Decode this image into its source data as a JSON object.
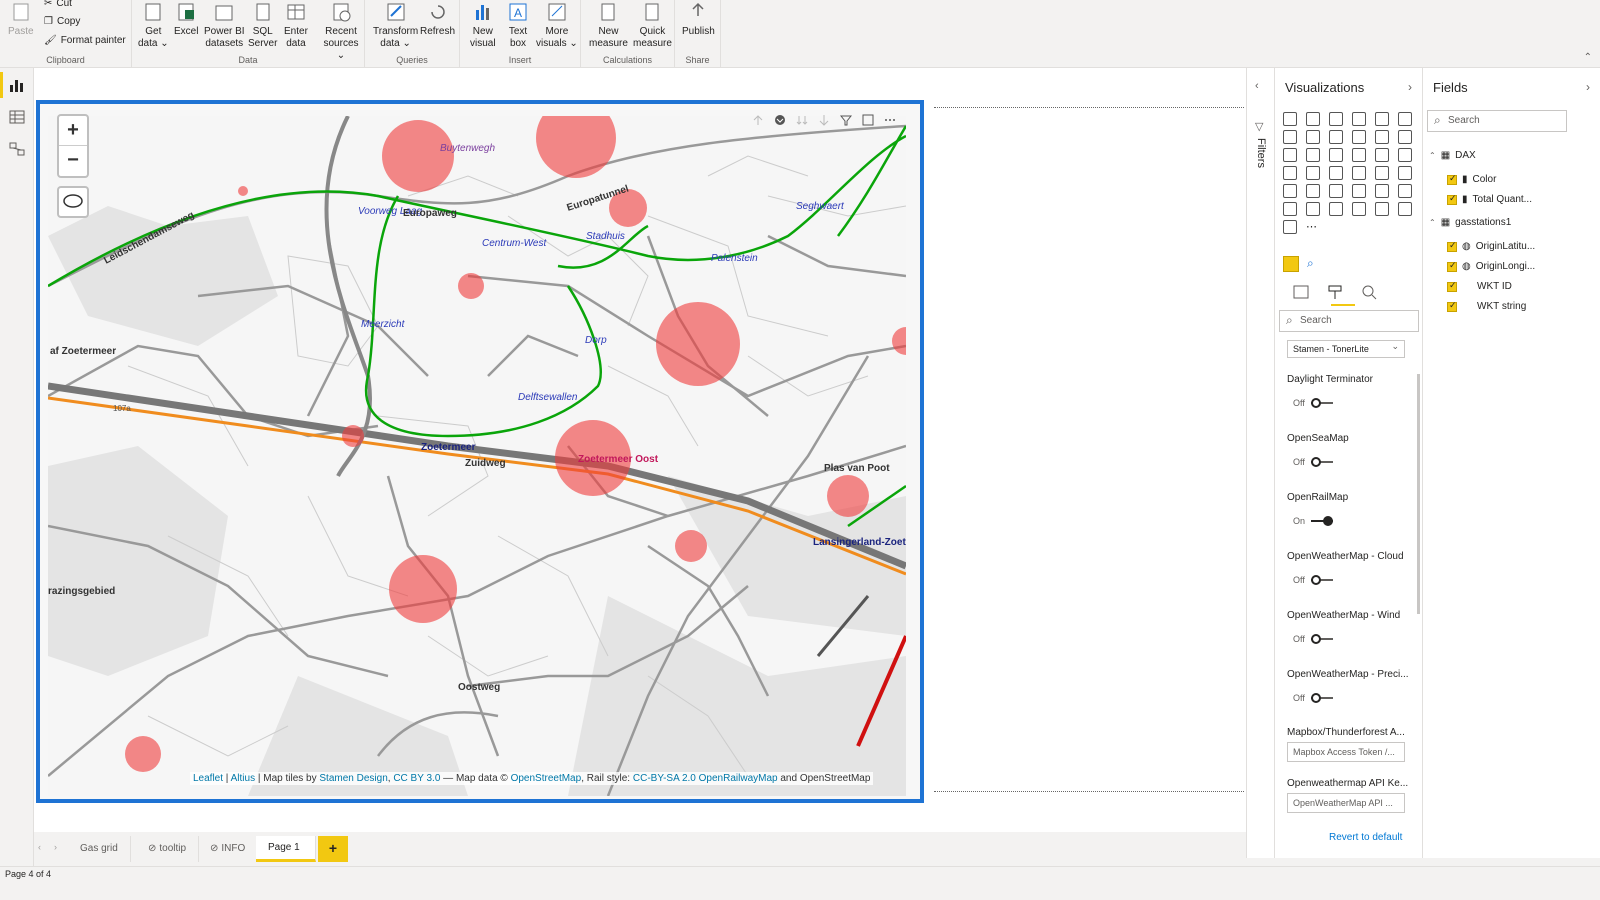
{
  "ribbon": {
    "clipboard": {
      "paste": "Paste",
      "cut": "Cut",
      "copy": "Copy",
      "format_painter": "Format painter",
      "label": "Clipboard"
    },
    "data": {
      "label": "Data",
      "buttons": [
        {
          "l1": "Get",
          "l2": "data ⌄"
        },
        {
          "l1": "Excel",
          "l2": ""
        },
        {
          "l1": "Power BI",
          "l2": "datasets"
        },
        {
          "l1": "SQL",
          "l2": "Server"
        },
        {
          "l1": "Enter",
          "l2": "data"
        },
        {
          "l1": "Recent",
          "l2": "sources ⌄"
        }
      ]
    },
    "queries": {
      "label": "Queries",
      "buttons": [
        {
          "l1": "Transform",
          "l2": "data ⌄"
        },
        {
          "l1": "Refresh",
          "l2": ""
        }
      ]
    },
    "insert": {
      "label": "Insert",
      "buttons": [
        {
          "l1": "New",
          "l2": "visual"
        },
        {
          "l1": "Text",
          "l2": "box"
        },
        {
          "l1": "More",
          "l2": "visuals ⌄"
        }
      ]
    },
    "calculations": {
      "label": "Calculations",
      "buttons": [
        {
          "l1": "New",
          "l2": "measure"
        },
        {
          "l1": "Quick",
          "l2": "measure"
        }
      ]
    },
    "share": {
      "label": "Share",
      "buttons": [
        {
          "l1": "Publish",
          "l2": ""
        }
      ]
    }
  },
  "map": {
    "labels": [
      {
        "t": "Buytenwegh",
        "c": "#7b3f9e"
      },
      {
        "t": "Voorweg Laag",
        "c": "#2b3ab8"
      },
      {
        "t": "Centrum-West",
        "c": "#2b3ab8"
      },
      {
        "t": "Stadhuis",
        "c": "#2b3ab8"
      },
      {
        "t": "Seghwaert",
        "c": "#2b3ab8"
      },
      {
        "t": "Palenstein",
        "c": "#2b3ab8"
      },
      {
        "t": "Meerzicht",
        "c": "#2b3ab8"
      },
      {
        "t": "Dorp",
        "c": "#2b3ab8"
      },
      {
        "t": "Delftsewallen",
        "c": "#2b3ab8"
      },
      {
        "t": "Zoetermeer",
        "c": "#1a237e"
      },
      {
        "t": "Zoetermeer Oost",
        "c": "#c2185b"
      },
      {
        "t": "Lansingerland-Zoetermeer",
        "c": "#1a237e"
      },
      {
        "t": "Leidschendamseweg",
        "c": "#333333"
      },
      {
        "t": "Europaweg",
        "c": "#333333"
      },
      {
        "t": "Europatunnel",
        "c": "#333333"
      },
      {
        "t": "Zuidweg",
        "c": "#333333"
      },
      {
        "t": "Oostweg",
        "c": "#333333"
      },
      {
        "t": "Plas van Poot",
        "c": "#333333"
      },
      {
        "t": "af Zoetermeer",
        "c": "#333333"
      },
      {
        "t": "razingsgebied",
        "c": "#333333"
      },
      {
        "t": "107a",
        "c": "#555555"
      }
    ],
    "attribution": {
      "leaflet": "Leaflet",
      "sep1": " | ",
      "altius": "Altius",
      "tiles": " | Map tiles by ",
      "stamen": "Stamen Design",
      "comma": ", ",
      "ccby": "CC BY 3.0",
      "mapdata": " — Map data © ",
      "osm": "OpenStreetMap",
      "rail": ", Rail style: ",
      "ccbysa": "CC-BY-SA 2.0",
      "orm": "OpenRailwayMap",
      "and": " and OpenStreetMap"
    }
  },
  "tabs": [
    "Gas grid",
    "tooltip",
    "INFO",
    "Page 1"
  ],
  "status": "Page 4 of 4",
  "filters_label": "Filters",
  "viz": {
    "title": "Visualizations",
    "search": "Search",
    "basemap": "Stamen - TonerLite",
    "props": [
      {
        "name": "Daylight Terminator",
        "state": "Off",
        "on": false
      },
      {
        "name": "OpenSeaMap",
        "state": "Off",
        "on": false
      },
      {
        "name": "OpenRailMap",
        "state": "On",
        "on": true
      },
      {
        "name": "OpenWeatherMap - Cloud",
        "state": "Off",
        "on": false
      },
      {
        "name": "OpenWeatherMap - Wind",
        "state": "Off",
        "on": false
      },
      {
        "name": "OpenWeatherMap - Preci...",
        "state": "Off",
        "on": false
      }
    ],
    "mapbox_label": "Mapbox/Thunderforest A...",
    "mapbox_placeholder": "Mapbox Access Token /...",
    "owm_label": "Openweathermap API Ke...",
    "owm_placeholder": "OpenWeatherMap API ...",
    "revert": "Revert to default"
  },
  "fields": {
    "title": "Fields",
    "search": "Search",
    "tables": [
      {
        "name": "DAX",
        "items": [
          "Color",
          "Total Quant..."
        ]
      },
      {
        "name": "gasstations1",
        "items": [
          "OriginLatitu...",
          "OriginLongi...",
          "WKT ID",
          "WKT string"
        ]
      }
    ]
  },
  "colors": {
    "accent": "#f2c811",
    "selection": "#1e73d4",
    "marker": "#f03c3c",
    "rail": "#0aa50a",
    "motorway": "#f08c1e"
  }
}
